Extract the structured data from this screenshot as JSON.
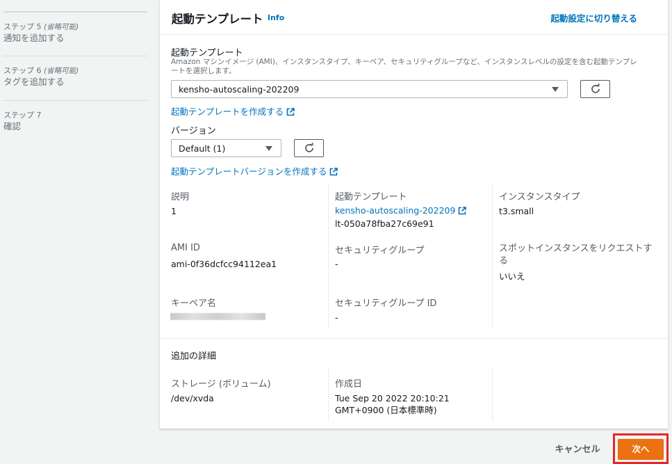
{
  "steps": [
    {
      "num": "ステップ 5",
      "optional": "(省略可能)",
      "label": "通知を追加する"
    },
    {
      "num": "ステップ 6",
      "optional": "(省略可能)",
      "label": "タグを追加する"
    },
    {
      "num": "ステップ 7",
      "optional": "",
      "label": "確認"
    }
  ],
  "card": {
    "title": "起動テンプレート",
    "info": "Info",
    "switch_link": "起動設定に切り替える"
  },
  "template_field": {
    "label": "起動テンプレート",
    "description": "Amazon マシンイメージ (AMI)、インスタンスタイプ、キーペア、セキュリティグループなど、インスタンスレベルの設定を含む起動テンプレートを選択します。",
    "selected": "kensho-autoscaling-202209",
    "create_link": "起動テンプレートを作成する"
  },
  "version_field": {
    "label": "バージョン",
    "selected": "Default (1)",
    "create_link": "起動テンプレートバージョンを作成する"
  },
  "details": {
    "description_label": "説明",
    "description_value": "1",
    "template_label": "起動テンプレート",
    "template_link": "kensho-autoscaling-202209",
    "template_id": "lt-050a78fba27c69e91",
    "instance_type_label": "インスタンスタイプ",
    "instance_type_value": "t3.small",
    "ami_label": "AMI ID",
    "ami_value": "ami-0f36dcfcc94112ea1",
    "sg_label": "セキュリティグループ",
    "sg_value": "-",
    "spot_label": "スポットインスタンスをリクエストする",
    "spot_value": "いいえ",
    "keypair_label": "キーペア名",
    "sgid_label": "セキュリティグループ ID",
    "sgid_value": "-"
  },
  "additional": {
    "heading": "追加の詳細",
    "storage_label": "ストレージ (ボリューム)",
    "storage_value": "/dev/xvda",
    "created_label": "作成日",
    "created_value": "Tue Sep 20 2022 20:10:21 GMT+0900 (日本標準時)"
  },
  "footer": {
    "cancel": "キャンセル",
    "next": "次へ"
  },
  "colors": {
    "link": "#0073bb",
    "primary": "#ec7211",
    "highlight": "#e5252a"
  }
}
